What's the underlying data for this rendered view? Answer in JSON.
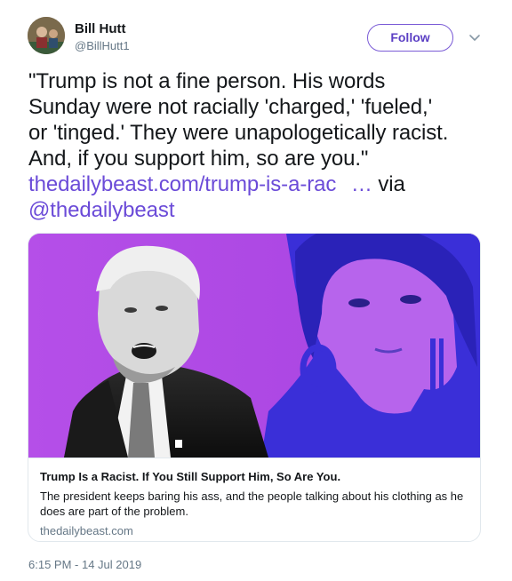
{
  "user": {
    "display_name": "Bill Hutt",
    "handle": "@BillHutt1"
  },
  "actions": {
    "follow_label": "Follow"
  },
  "tweet": {
    "quote_line1": "\"Trump is not a fine person. His words",
    "quote_line2": "Sunday were not racially 'charged,' 'fueled,'",
    "quote_line3": "or 'tinged.' They were unapologetically racist.",
    "quote_line4": "And, if you support him, so are you.\"",
    "link_text": "thedailybeast.com/trump-is-a-rac",
    "ellipsis": "…",
    "via": "via",
    "mention": "@thedailybeast"
  },
  "card": {
    "title": "Trump Is a Racist. If You Still Support Him, So Are You.",
    "description": "The president keeps baring his ass, and the people talking about his clothing as he does are part of the problem.",
    "domain": "thedailybeast.com"
  },
  "timestamp": "6:15 PM - 14 Jul 2019",
  "colors": {
    "accent": "#6b4bd8",
    "card_bg_magenta": "#b04be6",
    "card_bg_blue": "#3c2de0"
  }
}
